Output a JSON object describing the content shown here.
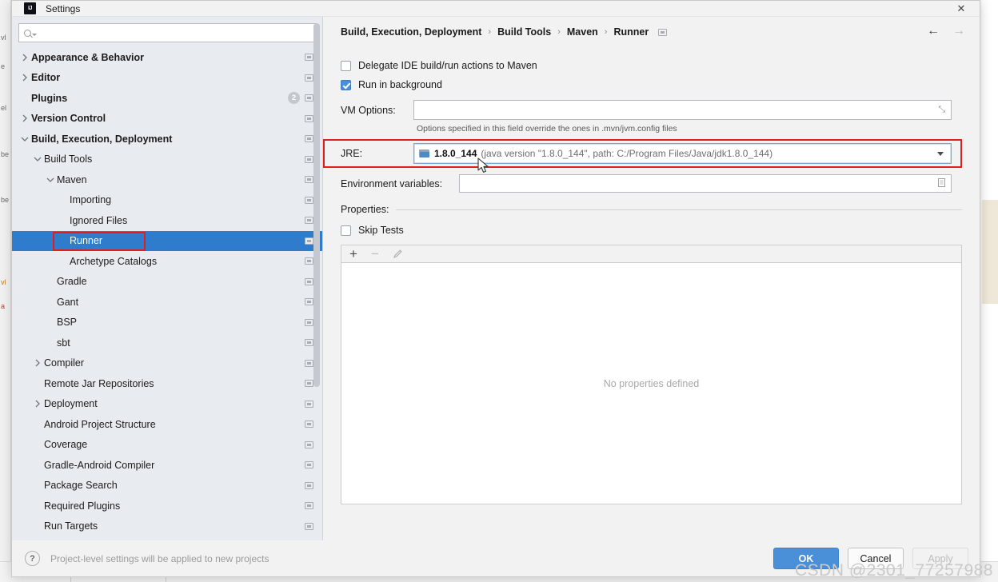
{
  "window": {
    "title": "Settings",
    "logo_text": "IJ",
    "close_icon": "close-icon"
  },
  "search": {
    "value": "",
    "placeholder": ""
  },
  "sidebar": {
    "items": [
      {
        "label": "Appearance & Behavior",
        "indent": 0,
        "chevron": "right",
        "bold": true,
        "selected": false,
        "monitor": true,
        "badge": ""
      },
      {
        "label": "Editor",
        "indent": 0,
        "chevron": "right",
        "bold": true,
        "selected": false,
        "monitor": true,
        "badge": ""
      },
      {
        "label": "Plugins",
        "indent": 0,
        "chevron": "none",
        "bold": true,
        "selected": false,
        "monitor": true,
        "badge": "2"
      },
      {
        "label": "Version Control",
        "indent": 0,
        "chevron": "right",
        "bold": true,
        "selected": false,
        "monitor": true,
        "badge": ""
      },
      {
        "label": "Build, Execution, Deployment",
        "indent": 0,
        "chevron": "down",
        "bold": true,
        "selected": false,
        "monitor": true,
        "badge": ""
      },
      {
        "label": "Build Tools",
        "indent": 1,
        "chevron": "down",
        "bold": false,
        "selected": false,
        "monitor": true,
        "badge": ""
      },
      {
        "label": "Maven",
        "indent": 2,
        "chevron": "down",
        "bold": false,
        "selected": false,
        "monitor": true,
        "badge": ""
      },
      {
        "label": "Importing",
        "indent": 3,
        "chevron": "none",
        "bold": false,
        "selected": false,
        "monitor": true,
        "badge": ""
      },
      {
        "label": "Ignored Files",
        "indent": 3,
        "chevron": "none",
        "bold": false,
        "selected": false,
        "monitor": true,
        "badge": ""
      },
      {
        "label": "Runner",
        "indent": 3,
        "chevron": "none",
        "bold": false,
        "selected": true,
        "monitor": true,
        "badge": ""
      },
      {
        "label": "Archetype Catalogs",
        "indent": 3,
        "chevron": "none",
        "bold": false,
        "selected": false,
        "monitor": true,
        "badge": ""
      },
      {
        "label": "Gradle",
        "indent": 2,
        "chevron": "none",
        "bold": false,
        "selected": false,
        "monitor": true,
        "badge": ""
      },
      {
        "label": "Gant",
        "indent": 2,
        "chevron": "none",
        "bold": false,
        "selected": false,
        "monitor": true,
        "badge": ""
      },
      {
        "label": "BSP",
        "indent": 2,
        "chevron": "none",
        "bold": false,
        "selected": false,
        "monitor": true,
        "badge": ""
      },
      {
        "label": "sbt",
        "indent": 2,
        "chevron": "none",
        "bold": false,
        "selected": false,
        "monitor": true,
        "badge": ""
      },
      {
        "label": "Compiler",
        "indent": 1,
        "chevron": "right",
        "bold": false,
        "selected": false,
        "monitor": true,
        "badge": ""
      },
      {
        "label": "Remote Jar Repositories",
        "indent": 1,
        "chevron": "none",
        "bold": false,
        "selected": false,
        "monitor": true,
        "badge": ""
      },
      {
        "label": "Deployment",
        "indent": 1,
        "chevron": "right",
        "bold": false,
        "selected": false,
        "monitor": true,
        "badge": ""
      },
      {
        "label": "Android Project Structure",
        "indent": 1,
        "chevron": "none",
        "bold": false,
        "selected": false,
        "monitor": true,
        "badge": ""
      },
      {
        "label": "Coverage",
        "indent": 1,
        "chevron": "none",
        "bold": false,
        "selected": false,
        "monitor": true,
        "badge": ""
      },
      {
        "label": "Gradle-Android Compiler",
        "indent": 1,
        "chevron": "none",
        "bold": false,
        "selected": false,
        "monitor": true,
        "badge": ""
      },
      {
        "label": "Package Search",
        "indent": 1,
        "chevron": "none",
        "bold": false,
        "selected": false,
        "monitor": true,
        "badge": ""
      },
      {
        "label": "Required Plugins",
        "indent": 1,
        "chevron": "none",
        "bold": false,
        "selected": false,
        "monitor": true,
        "badge": ""
      },
      {
        "label": "Run Targets",
        "indent": 1,
        "chevron": "none",
        "bold": false,
        "selected": false,
        "monitor": true,
        "badge": ""
      }
    ]
  },
  "content": {
    "breadcrumb": [
      "Build, Execution, Deployment",
      "Build Tools",
      "Maven",
      "Runner"
    ],
    "breadcrumb_separator": "›",
    "nav": {
      "back_icon": "arrow-left-icon",
      "forward_icon": "arrow-right-icon",
      "back_glyph": "←",
      "forward_glyph": "→"
    },
    "delegate_checkbox": {
      "label": "Delegate IDE build/run actions to Maven",
      "checked": false
    },
    "run_background_checkbox": {
      "label": "Run in background",
      "checked": true
    },
    "vm_options": {
      "label": "VM Options:",
      "value": "",
      "expand_icon": "expand-icon",
      "expand_glyph": "⤡"
    },
    "vm_options_hint": "Options specified in this field override the ones in .mvn/jvm.config files",
    "jre": {
      "label": "JRE:",
      "icon": "jdk-folder-icon",
      "name": "1.8.0_144",
      "detail": "(java version \"1.8.0_144\", path: C:/Program Files/Java/jdk1.8.0_144)",
      "dropdown_icon": "chevron-down-icon"
    },
    "environment_variables": {
      "label": "Environment variables:",
      "value": "",
      "browse_icon": "browse-icon"
    },
    "properties": {
      "label": "Properties:",
      "skip_tests": {
        "label": "Skip Tests",
        "checked": false
      },
      "toolbar": {
        "add_icon": "plus-icon",
        "add_glyph": "+",
        "remove_icon": "minus-icon",
        "remove_glyph": "−",
        "edit_icon": "pencil-icon"
      },
      "empty_message": "No properties defined"
    }
  },
  "footer": {
    "help_icon": "help-icon",
    "help_glyph": "?",
    "note": "Project-level settings will be applied to new projects",
    "ok_label": "OK",
    "cancel_label": "Cancel",
    "apply_label": "Apply"
  },
  "watermark": "CSDN @2301_77257988",
  "colors": {
    "selection_blue": "#2f7ccc",
    "primary_button": "#4a90d9",
    "annotation_red": "#e02020",
    "sidebar_bg": "#e8ebf0"
  }
}
